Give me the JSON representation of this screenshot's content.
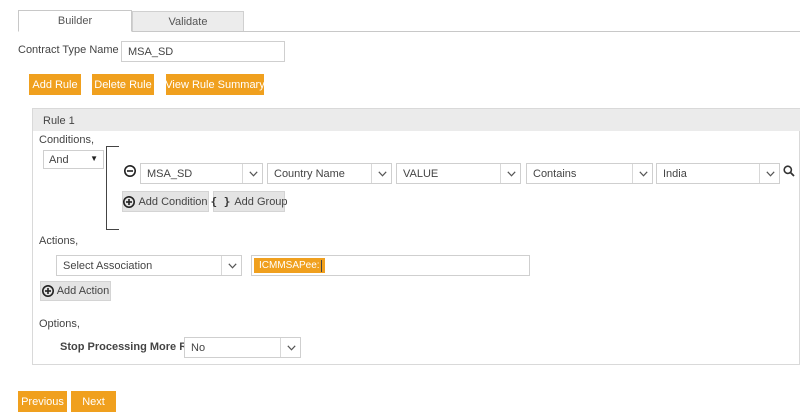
{
  "tabs": {
    "builder": "Builder",
    "validate": "Validate"
  },
  "contract": {
    "label": "Contract Type Name",
    "value": "MSA_SD"
  },
  "toolbar": {
    "add_rule": "Add Rule",
    "delete_rule": "Delete Rule",
    "view_summary": "View Rule Summary"
  },
  "rule": {
    "title": "Rule 1",
    "conditions_label": "Conditions,",
    "logic_operator": "And",
    "condition": {
      "entity": "MSA_SD",
      "field": "Country Name",
      "value_type": "VALUE",
      "operator": "Contains",
      "value": "India"
    },
    "add_condition": "Add Condition",
    "add_group": "Add Group",
    "actions_label": "Actions,",
    "association_placeholder": "Select Association",
    "action_tag": "ICMMSAPee:",
    "add_action": "Add Action",
    "options_label": "Options,",
    "stop_processing_label": "Stop Processing More Rules",
    "stop_processing_value": "No"
  },
  "nav": {
    "previous": "Previous",
    "next": "Next"
  },
  "colors": {
    "accent": "#f0a01e"
  },
  "icons": [
    "minus-circle-icon",
    "plus-circle-icon",
    "braces-icon",
    "search-icon",
    "chevron-down-icon"
  ]
}
